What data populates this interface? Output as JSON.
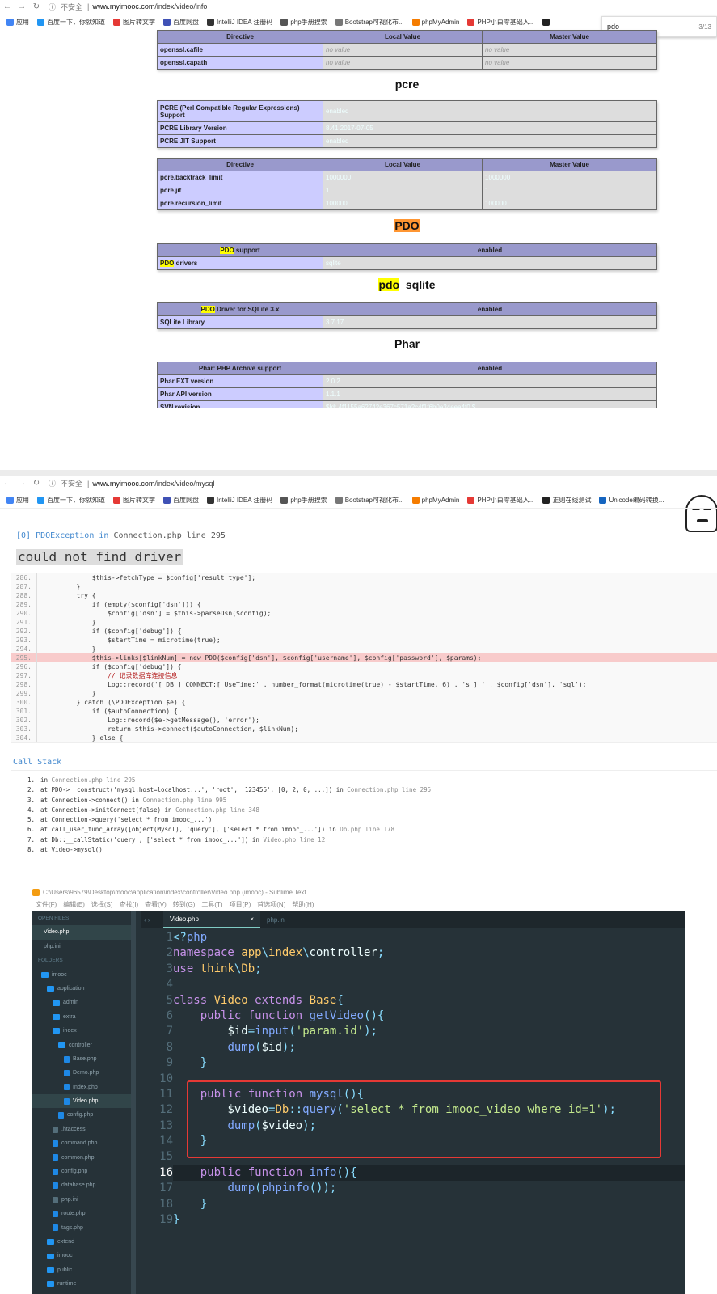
{
  "browser1": {
    "insecure": "不安全",
    "url_host": "www.myimooc.com",
    "url_path": "/index/video/info",
    "find": {
      "query": "pdo",
      "count": "3/13"
    }
  },
  "bookmarks1": [
    "应用",
    "百度一下，你就知道",
    "图片转文字",
    "百度网盘",
    "IntelliJ IDEA 注册码",
    "php手册搜索",
    "Bootstrap可视化布...",
    "phpMyAdmin",
    "PHP小白零基础入...",
    ""
  ],
  "phpinfo": {
    "openssl_header": [
      "Directive",
      "Local Value",
      "Master Value"
    ],
    "openssl_rows": [
      {
        "d": "openssl.cafile",
        "l": "no value",
        "m": "no value"
      },
      {
        "d": "openssl.capath",
        "l": "no value",
        "m": "no value"
      }
    ],
    "pcre_title": "pcre",
    "pcre_support": [
      {
        "k": "PCRE (Perl Compatible Regular Expressions) Support",
        "v": "enabled"
      },
      {
        "k": "PCRE Library Version",
        "v": "8.41 2017-07-05"
      },
      {
        "k": "PCRE JIT Support",
        "v": "enabled"
      }
    ],
    "pcre_header": [
      "Directive",
      "Local Value",
      "Master Value"
    ],
    "pcre_rows": [
      {
        "d": "pcre.backtrack_limit",
        "l": "1000000",
        "m": "1000000"
      },
      {
        "d": "pcre.jit",
        "l": "1",
        "m": "1"
      },
      {
        "d": "pcre.recursion_limit",
        "l": "100000",
        "m": "100000"
      }
    ],
    "pdo_title": "PDO",
    "pdo_header_a": "PDO",
    "pdo_header_b": " support",
    "pdo_header_c": "enabled",
    "pdo_drivers_a": "PDO",
    "pdo_drivers_b": " drivers",
    "pdo_drivers_v": "sqlite",
    "pdo_sqlite_a": "pdo",
    "pdo_sqlite_b": "_sqlite",
    "sqlite_header_a": "PDO",
    "sqlite_header_b": " Driver for SQLite 3.x",
    "sqlite_header_c": "enabled",
    "sqlite_lib_k": "SQLite Library",
    "sqlite_lib_v": "3.7.17",
    "phar_title": "Phar",
    "phar_header": [
      "Phar: PHP Archive support",
      "enabled"
    ],
    "phar_rows": [
      {
        "k": "Phar EXT version",
        "v": "2.0.2"
      },
      {
        "k": "Phar API version",
        "v": "1.1.1"
      },
      {
        "k": "SVN revision",
        "v": "$Id: 4f1155a62742e367c571a2c4f1f6b0e34eea4f0 $"
      }
    ]
  },
  "browser2": {
    "insecure": "不安全",
    "url_host": "www.myimooc.com",
    "url_path": "/index/video/mysql"
  },
  "bookmarks2": [
    "应用",
    "百度一下，你就知道",
    "图片转文字",
    "百度网盘",
    "IntelliJ IDEA 注册码",
    "php手册搜索",
    "Bootstrap可视化布...",
    "phpMyAdmin",
    "PHP小白零基础入...",
    "正则在线测试",
    "Unicode编码转换..."
  ],
  "error": {
    "index": "[0]",
    "exception": "PDOException",
    "in": " in ",
    "file": "Connection.php line 295",
    "message": "could not find driver"
  },
  "source_lines": [
    {
      "n": "286.",
      "c": "            $this->fetchType = $config['result_type'];"
    },
    {
      "n": "287.",
      "c": "        }"
    },
    {
      "n": "288.",
      "c": "        try {"
    },
    {
      "n": "289.",
      "c": "            if (empty($config['dsn'])) {"
    },
    {
      "n": "290.",
      "c": "                $config['dsn'] = $this->parseDsn($config);"
    },
    {
      "n": "291.",
      "c": "            }"
    },
    {
      "n": "292.",
      "c": "            if ($config['debug']) {"
    },
    {
      "n": "293.",
      "c": "                $startTime = microtime(true);"
    },
    {
      "n": "294.",
      "c": "            }"
    },
    {
      "n": "295.",
      "c": "            $this->links[$linkNum] = new PDO($config['dsn'], $config['username'], $config['password'], $params);"
    },
    {
      "n": "296.",
      "c": "            if ($config['debug']) {"
    },
    {
      "n": "297.",
      "c": "                // 记录数据库连接信息"
    },
    {
      "n": "298.",
      "c": "                Log::record('[ DB ] CONNECT:[ UseTime:' . number_format(microtime(true) - $startTime, 6) . 's ] ' . $config['dsn'], 'sql');"
    },
    {
      "n": "299.",
      "c": "            }"
    },
    {
      "n": "300.",
      "c": "        } catch (\\PDOException $e) {"
    },
    {
      "n": "301.",
      "c": "            if ($autoConnection) {"
    },
    {
      "n": "302.",
      "c": "                Log::record($e->getMessage(), 'error');"
    },
    {
      "n": "303.",
      "c": "                return $this->connect($autoConnection, $linkNum);"
    },
    {
      "n": "304.",
      "c": "            } else {"
    }
  ],
  "callstack_title": "Call Stack",
  "callstack": [
    {
      "n": "1.",
      "t": "in ",
      "g": "Connection.php line 295"
    },
    {
      "n": "2.",
      "t": "at PDO->__construct('mysql:host=localhost...', 'root', '123456', [0, 2, 0, ...]) in ",
      "g": "Connection.php line 295"
    },
    {
      "n": "3.",
      "t": "at Connection->connect() in ",
      "g": "Connection.php line 995"
    },
    {
      "n": "4.",
      "t": "at Connection->initConnect(false) in ",
      "g": "Connection.php line 348"
    },
    {
      "n": "5.",
      "t": "at Connection->query('select * from imooc_...')",
      "g": ""
    },
    {
      "n": "6.",
      "t": "at call_user_func_array([object(Mysql), 'query'], ['select * from imooc_...']) in ",
      "g": "Db.php line 178"
    },
    {
      "n": "7.",
      "t": "at Db::__callStatic('query', ['select * from imooc_...']) in ",
      "g": "Video.php line 12"
    },
    {
      "n": "8.",
      "t": "at Video->mysql()",
      "g": ""
    }
  ],
  "sublime": {
    "title": "C:\\Users\\96579\\Desktop\\mooc\\application\\index\\controller\\Video.php (imooc) - Sublime Text",
    "menu": [
      "文件(F)",
      "编辑(E)",
      "选择(S)",
      "查找(I)",
      "查看(V)",
      "转到(G)",
      "工具(T)",
      "项目(P)",
      "首选项(N)",
      "帮助(H)"
    ],
    "tabs": [
      {
        "label": "Video.php",
        "close": "×"
      },
      {
        "label": "php.ini",
        "close": ""
      }
    ],
    "sidebar": [
      {
        "label": "OPEN FILES",
        "type": "hd",
        "indent": 0
      },
      {
        "label": "Video.php",
        "type": "open-sel",
        "indent": 0
      },
      {
        "label": "php.ini",
        "type": "open",
        "indent": 0
      },
      {
        "label": "FOLDERS",
        "type": "hd",
        "indent": 0
      },
      {
        "label": "imooc",
        "type": "folder",
        "indent": 1
      },
      {
        "label": "application",
        "type": "folder",
        "indent": 2
      },
      {
        "label": "admin",
        "type": "folder",
        "indent": 3
      },
      {
        "label": "extra",
        "type": "folder",
        "indent": 3
      },
      {
        "label": "index",
        "type": "folder",
        "indent": 3
      },
      {
        "label": "controller",
        "type": "folder",
        "indent": 4
      },
      {
        "label": "Base.php",
        "type": "php",
        "indent": 5
      },
      {
        "label": "Demo.php",
        "type": "php",
        "indent": 5
      },
      {
        "label": "Index.php",
        "type": "php",
        "indent": 5
      },
      {
        "label": "Video.php",
        "type": "php-sel",
        "indent": 5
      },
      {
        "label": "config.php",
        "type": "php",
        "indent": 4
      },
      {
        "label": ".htaccess",
        "type": "file",
        "indent": 3
      },
      {
        "label": "command.php",
        "type": "php",
        "indent": 3
      },
      {
        "label": "common.php",
        "type": "php",
        "indent": 3
      },
      {
        "label": "config.php",
        "type": "php",
        "indent": 3
      },
      {
        "label": "database.php",
        "type": "php",
        "indent": 3
      },
      {
        "label": "php.ini",
        "type": "file",
        "indent": 3
      },
      {
        "label": "route.php",
        "type": "php",
        "indent": 3
      },
      {
        "label": "tags.php",
        "type": "php",
        "indent": 3
      },
      {
        "label": "extend",
        "type": "folder",
        "indent": 2
      },
      {
        "label": "imooc",
        "type": "folder",
        "indent": 2
      },
      {
        "label": "public",
        "type": "folder",
        "indent": 2
      },
      {
        "label": "runtime",
        "type": "folder",
        "indent": 2
      }
    ],
    "line_numbers": [
      "1",
      "2",
      "3",
      "4",
      "5",
      "6",
      "7",
      "8",
      "9",
      "10",
      "11",
      "12",
      "13",
      "14",
      "15",
      "16",
      "17",
      "18",
      "19"
    ],
    "current_line": "16"
  }
}
